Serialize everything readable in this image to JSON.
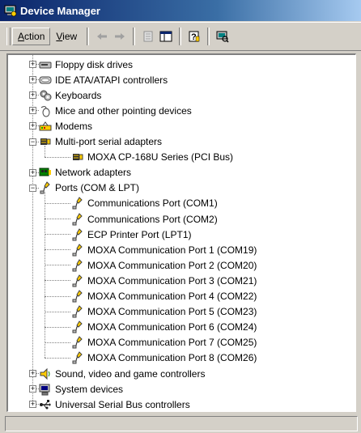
{
  "window": {
    "title": "Device Manager"
  },
  "menu": {
    "action_prefix": "",
    "action_underline": "A",
    "action_rest": "ction",
    "view_underline": "V",
    "view_rest": "iew"
  },
  "toolbar": {
    "icons": [
      "back-arrow-icon",
      "forward-arrow-icon",
      "properties-icon",
      "show-hide-tree-icon",
      "help-icon",
      "scan-hardware-icon"
    ]
  },
  "tree": {
    "categories": [
      {
        "label": "Floppy disk drives",
        "icon": "floppy-drive-icon",
        "expanded": false
      },
      {
        "label": "IDE ATA/ATAPI controllers",
        "icon": "ide-controller-icon",
        "expanded": false
      },
      {
        "label": "Keyboards",
        "icon": "keyboard-icon",
        "expanded": false
      },
      {
        "label": "Mice and other pointing devices",
        "icon": "mouse-icon",
        "expanded": false
      },
      {
        "label": "Modems",
        "icon": "modem-icon",
        "expanded": false
      },
      {
        "label": "Multi-port serial adapters",
        "icon": "serial-adapter-icon",
        "expanded": true,
        "children": [
          "MOXA CP-168U Series (PCI Bus)"
        ]
      },
      {
        "label": "Network adapters",
        "icon": "network-adapter-icon",
        "expanded": false
      },
      {
        "label": "Ports (COM & LPT)",
        "icon": "port-icon",
        "expanded": true,
        "children": [
          "Communications Port (COM1)",
          "Communications Port (COM2)",
          "ECP Printer Port (LPT1)",
          "MOXA Communication Port 1 (COM19)",
          "MOXA Communication Port 2 (COM20)",
          "MOXA Communication Port 3 (COM21)",
          "MOXA Communication Port 4 (COM22)",
          "MOXA Communication Port 5 (COM23)",
          "MOXA Communication Port 6 (COM24)",
          "MOXA Communication Port 7 (COM25)",
          "MOXA Communication Port 8 (COM26)"
        ]
      },
      {
        "label": "Sound, video and game controllers",
        "icon": "sound-icon",
        "expanded": false
      },
      {
        "label": "System devices",
        "icon": "system-devices-icon",
        "expanded": false
      },
      {
        "label": "Universal Serial Bus controllers",
        "icon": "usb-icon",
        "expanded": false
      }
    ]
  },
  "status_bar": {
    "text": ""
  }
}
